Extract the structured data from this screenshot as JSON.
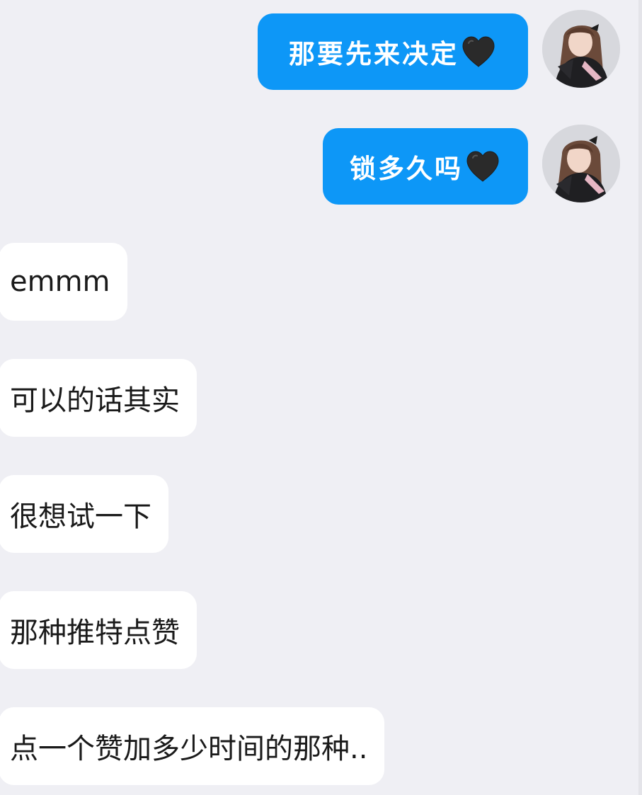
{
  "chat": {
    "messages": [
      {
        "direction": "outgoing",
        "text": "那要先来决定",
        "emoji": "black-heart"
      },
      {
        "direction": "outgoing",
        "text": "锁多久吗",
        "emoji": "black-heart"
      },
      {
        "direction": "incoming",
        "text": "emmm"
      },
      {
        "direction": "incoming",
        "text": "可以的话其实"
      },
      {
        "direction": "incoming",
        "text": "很想试一下"
      },
      {
        "direction": "incoming",
        "text": "那种推特点赞"
      },
      {
        "direction": "incoming",
        "text": "点一个赞加多少时间的那种.."
      }
    ]
  },
  "colors": {
    "outgoing_bubble": "#0d97f7",
    "incoming_bubble": "#ffffff",
    "background": "#efeff4",
    "heart": "#2a2a2a"
  }
}
